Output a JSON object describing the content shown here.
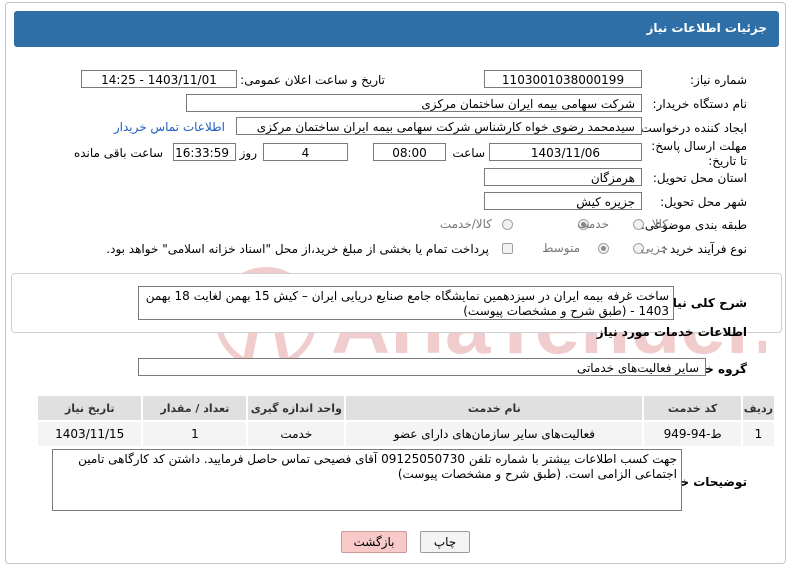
{
  "header": {
    "title": "جزئیات اطلاعات نیاز"
  },
  "form": {
    "need_number_label": "شماره نیاز:",
    "need_number": "1103001038000199",
    "announce_label": "تاریخ و ساعت اعلان عمومی:",
    "announce_value": "1403/11/01 - 14:25",
    "buyer_label": "نام دستگاه خریدار:",
    "buyer_value": "شرکت سهامی بیمه ایران ساختمان مرکزی",
    "creator_label": "ایجاد کننده درخواست:",
    "creator_value": "سیدمحمد رضوی خواه کارشناس شرکت سهامی بیمه ایران ساختمان مرکزی",
    "contact_link": "اطلاعات تماس خریدار",
    "deadline_label": "مهلت ارسال پاسخ: تا تاریخ:",
    "deadline_date": "1403/11/06",
    "time_label": "ساعت",
    "deadline_time": "08:00",
    "days_value": "4",
    "days_label": "روز و",
    "remaining_time": "16:33:59",
    "remaining_label": "ساعت باقی مانده",
    "province_label": "استان محل تحویل:",
    "province_value": "هرمزگان",
    "city_label": "شهر محل تحویل:",
    "city_value": "جزیره کیش",
    "category_label": "طبقه بندی موضوعی:",
    "category_options": [
      "کالا",
      "خدمت",
      "کالا/خدمت"
    ],
    "category_selected": "خدمت",
    "process_label": "نوع فرآیند خرید :",
    "process_options": [
      "جزیی",
      "متوسط"
    ],
    "process_selected": "متوسط",
    "payment_note": "پرداخت تمام یا بخشی از مبلغ خرید،از محل \"اسناد خزانه اسلامی\" خواهد بود."
  },
  "summary": {
    "label": "شرح کلی نیاز:",
    "text": "ساخت غرفه بیمه ایران در سیزدهمین نمایشگاه جامع صنایع دریایی ایران – کیش  15 بهمن لغایت 18 بهمن 1403 - (طبق شرح و مشخصات پیوست)"
  },
  "services": {
    "section_title": "اطلاعات خدمات مورد نیاز",
    "group_label": "گروه خدمت:",
    "group_value": "سایر فعالیت‌های خدماتی",
    "columns": [
      "ردیف",
      "کد خدمت",
      "نام خدمت",
      "واحد اندازه گیری",
      "تعداد / مقدار",
      "تاریخ نیاز"
    ],
    "rows": [
      [
        "1",
        "ط-94-949",
        "فعالیت‌های سایر سازمان‌های دارای عضو",
        "خدمت",
        "1",
        "1403/11/15"
      ]
    ]
  },
  "buyer_notes": {
    "label": "توضیحات خریدار:",
    "text": "جهت کسب اطلاعات بیشتر با شماره تلفن 09125050730  آقای فصیحی تماس حاصل فرمایید. داشتن کد کارگاهی تامین اجتماعی الزامی است. (طبق شرح و مشخصات پیوست)"
  },
  "buttons": {
    "print": "چاپ",
    "back": "بازگشت"
  },
  "watermark": {
    "text": "AriaTender.neT"
  },
  "colors": {
    "title_bar": "#2f6fa8",
    "link": "#1f5fbf",
    "back_button": "#f7c9c9",
    "watermark": "#e7a3a3"
  }
}
